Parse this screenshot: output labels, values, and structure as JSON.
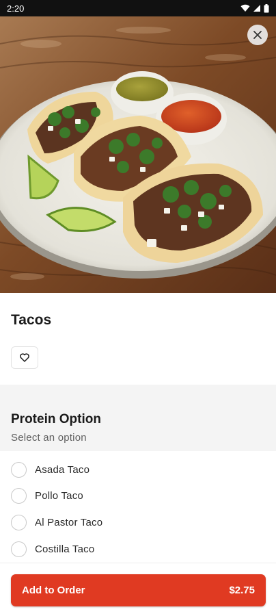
{
  "status_bar": {
    "time": "2:20",
    "icons": [
      "wifi-icon",
      "cell-signal-icon",
      "battery-icon"
    ]
  },
  "hero": {
    "image_subject": "tacos-photo",
    "close_icon": "close-icon"
  },
  "item": {
    "title": "Tacos",
    "favorite_icon": "heart-icon"
  },
  "option_group": {
    "title": "Protein Option",
    "subtitle": "Select an option",
    "options": [
      {
        "label": "Asada Taco",
        "selected": false
      },
      {
        "label": "Pollo Taco",
        "selected": false
      },
      {
        "label": "Al Pastor Taco",
        "selected": false
      },
      {
        "label": "Costilla Taco",
        "selected": false
      }
    ]
  },
  "footer": {
    "add_label": "Add to Order",
    "price": "$2.75"
  },
  "colors": {
    "accent": "#e03a22",
    "section_bg": "#f4f4f4",
    "status_bar": "#111111"
  }
}
